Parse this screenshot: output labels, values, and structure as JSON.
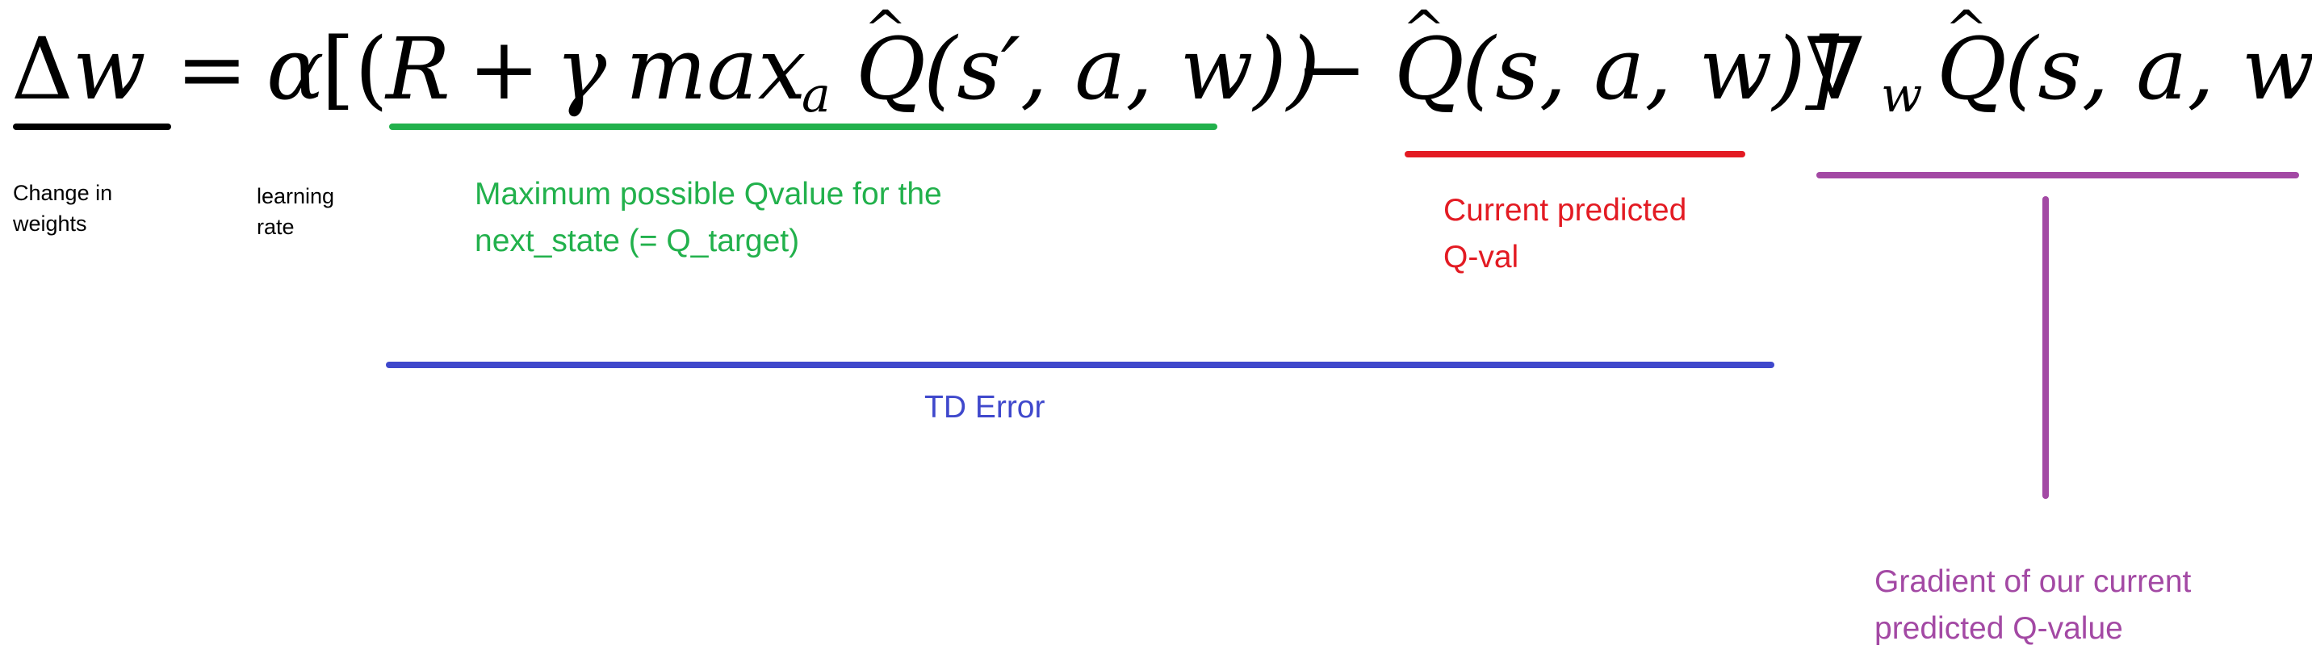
{
  "equation": {
    "delta": "Δ",
    "w": "w",
    "equals": "=",
    "alpha": "α",
    "open_brackets": "[(",
    "R": "R",
    "plus": "+",
    "gamma": "γ",
    "max": "max",
    "sub_a": "a",
    "Q_hat_1": "Q",
    "args_1": "(s′, a, w))",
    "minus": "−",
    "Q_hat_2": "Q",
    "args_2": "(s, a, w)]",
    "nabla": "∇",
    "sub_w": "w",
    "Q_hat_3": "Q",
    "args_3": "(s, a, w)"
  },
  "annotations": {
    "change_in_weights": {
      "line1": "Change in",
      "line2": "weights",
      "color": "#000000"
    },
    "learning_rate": {
      "line1": "learning",
      "line2": "rate",
      "color": "#000000"
    },
    "max_q": {
      "line1": "Maximum possible Qvalue for the",
      "line2": "next_state (= Q_target)",
      "color": "#22b14c"
    },
    "current_q": {
      "line1": "Current predicted",
      "line2": "Q-val",
      "color": "#e31b23"
    },
    "td_error": {
      "text": "TD Error",
      "color": "#3f48cc"
    },
    "gradient": {
      "line1": "Gradient of our current",
      "line2": "predicted Q-value",
      "color": "#a349a4"
    }
  }
}
